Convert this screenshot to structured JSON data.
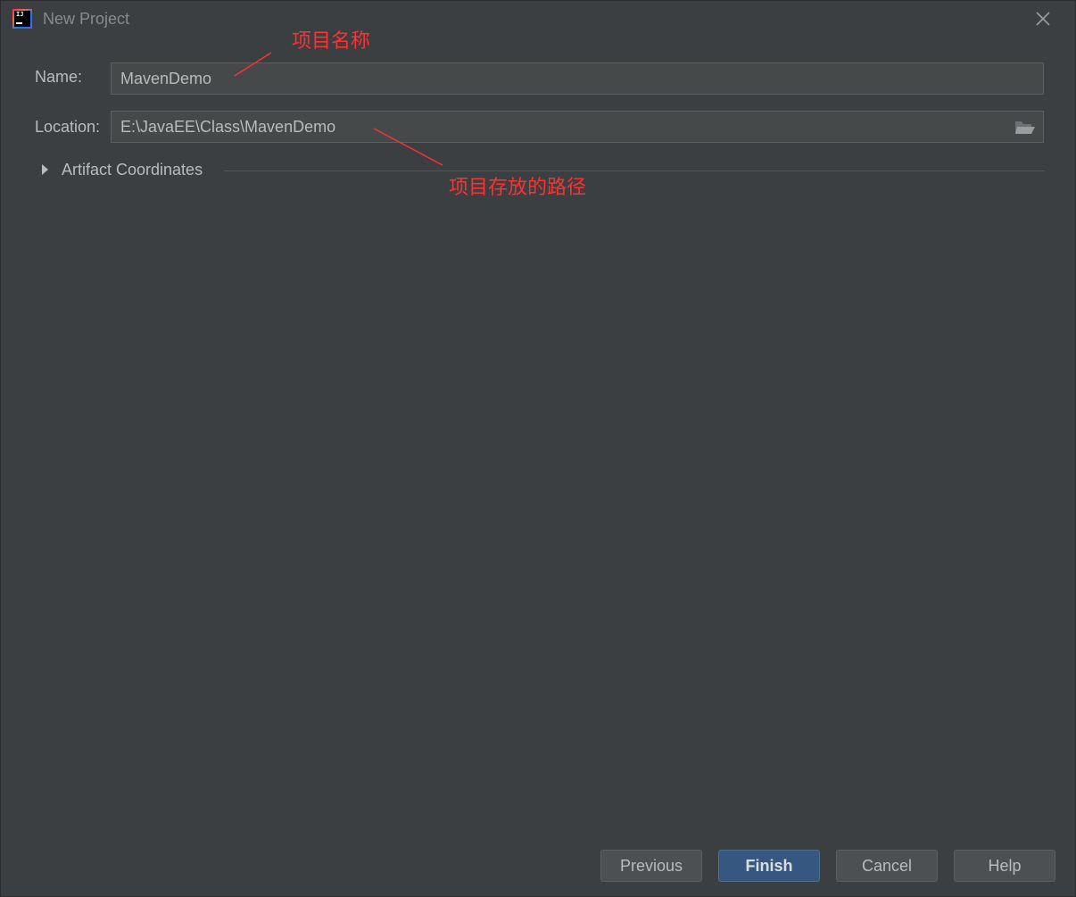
{
  "window": {
    "title": "New Project",
    "icon": "intellij-idea-icon",
    "icon_text": "IJ"
  },
  "form": {
    "name_label": "Name:",
    "name_value": "MavenDemo",
    "location_label": "Location:",
    "location_value": "E:\\JavaEE\\Class\\MavenDemo",
    "artifact_label": "Artifact Coordinates"
  },
  "annotations": {
    "name_note": "项目名称",
    "location_note": "项目存放的路径",
    "color": "#ff3030"
  },
  "buttons": {
    "previous": "Previous",
    "finish": "Finish",
    "cancel": "Cancel",
    "help": "Help"
  },
  "colors": {
    "background": "#3c3f41",
    "field_background": "#45494a",
    "default_button": "#365880",
    "text": "#bbbbbb"
  }
}
